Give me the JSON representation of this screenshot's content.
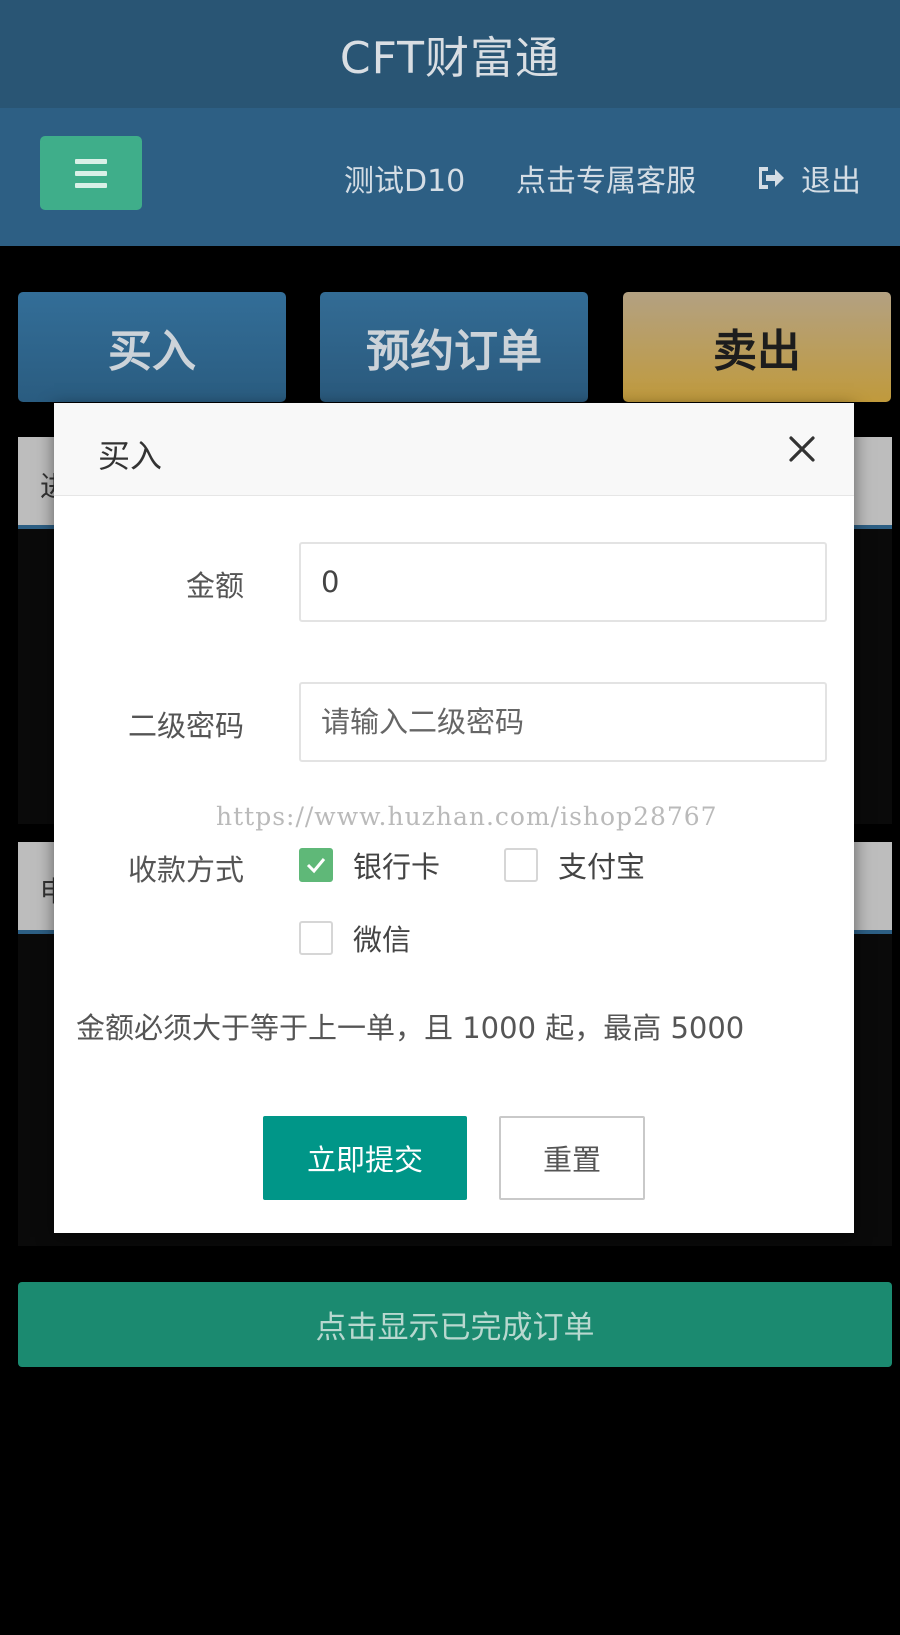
{
  "app": {
    "title": "CFT财富通"
  },
  "navbar": {
    "menu_icon": "hamburger-icon",
    "user_name": "测试D10",
    "service_label": "点击专属客服",
    "logout_icon": "sign-out-icon",
    "logout_label": "退出"
  },
  "tabs": {
    "buy": "买入",
    "reserve": "预约订单",
    "sell": "卖出"
  },
  "background": {
    "complete_orders_label": "点击显示已完成订单"
  },
  "modal": {
    "title": "买入",
    "close_icon": "close-icon",
    "amount_label": "金额",
    "amount_value": "0",
    "password_label": "二级密码",
    "password_placeholder": "请输入二级密码",
    "payment_label": "收款方式",
    "payment_options": [
      {
        "label": "银行卡",
        "checked": true
      },
      {
        "label": "支付宝",
        "checked": false
      },
      {
        "label": "微信",
        "checked": false
      }
    ],
    "hint": "金额必须大于等于上一单，且 1000 起，最高 5000",
    "submit_label": "立即提交",
    "reset_label": "重置"
  },
  "watermark": "https://www.huzhan.com/ishop28767",
  "colors": {
    "header": "#295574",
    "navbar": "#2d5f84",
    "menu_button": "#3fae8a",
    "sell_tab": "#c09a3c",
    "submit": "#009688",
    "checked": "#5fb878"
  }
}
